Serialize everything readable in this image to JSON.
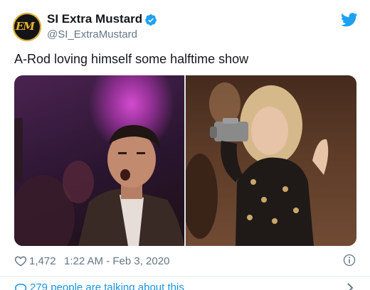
{
  "author": {
    "name": "SI Extra Mustard",
    "handle": "@SI_ExtraMustard",
    "avatar_logo_text": "EM",
    "verified": true
  },
  "tweet": {
    "text": "A-Rod loving himself some halftime show"
  },
  "media": {
    "left_image": "man-in-suit-cheering-photo",
    "right_image": "woman-with-camcorder-photo"
  },
  "stats": {
    "likes": "1,472",
    "timestamp": "1:22 AM - Feb 3, 2020"
  },
  "footer": {
    "conversation_text": "279 people are talking about this"
  },
  "icons": {
    "brand": "twitter-bird-icon",
    "verified": "verified-badge-icon",
    "like": "heart-icon",
    "info": "info-icon",
    "conversation": "comment-icon",
    "more": "chevron-right-icon"
  },
  "colors": {
    "accent": "#1da1f2",
    "link": "#1b95e0",
    "muted": "#657786",
    "text": "#14171a"
  }
}
